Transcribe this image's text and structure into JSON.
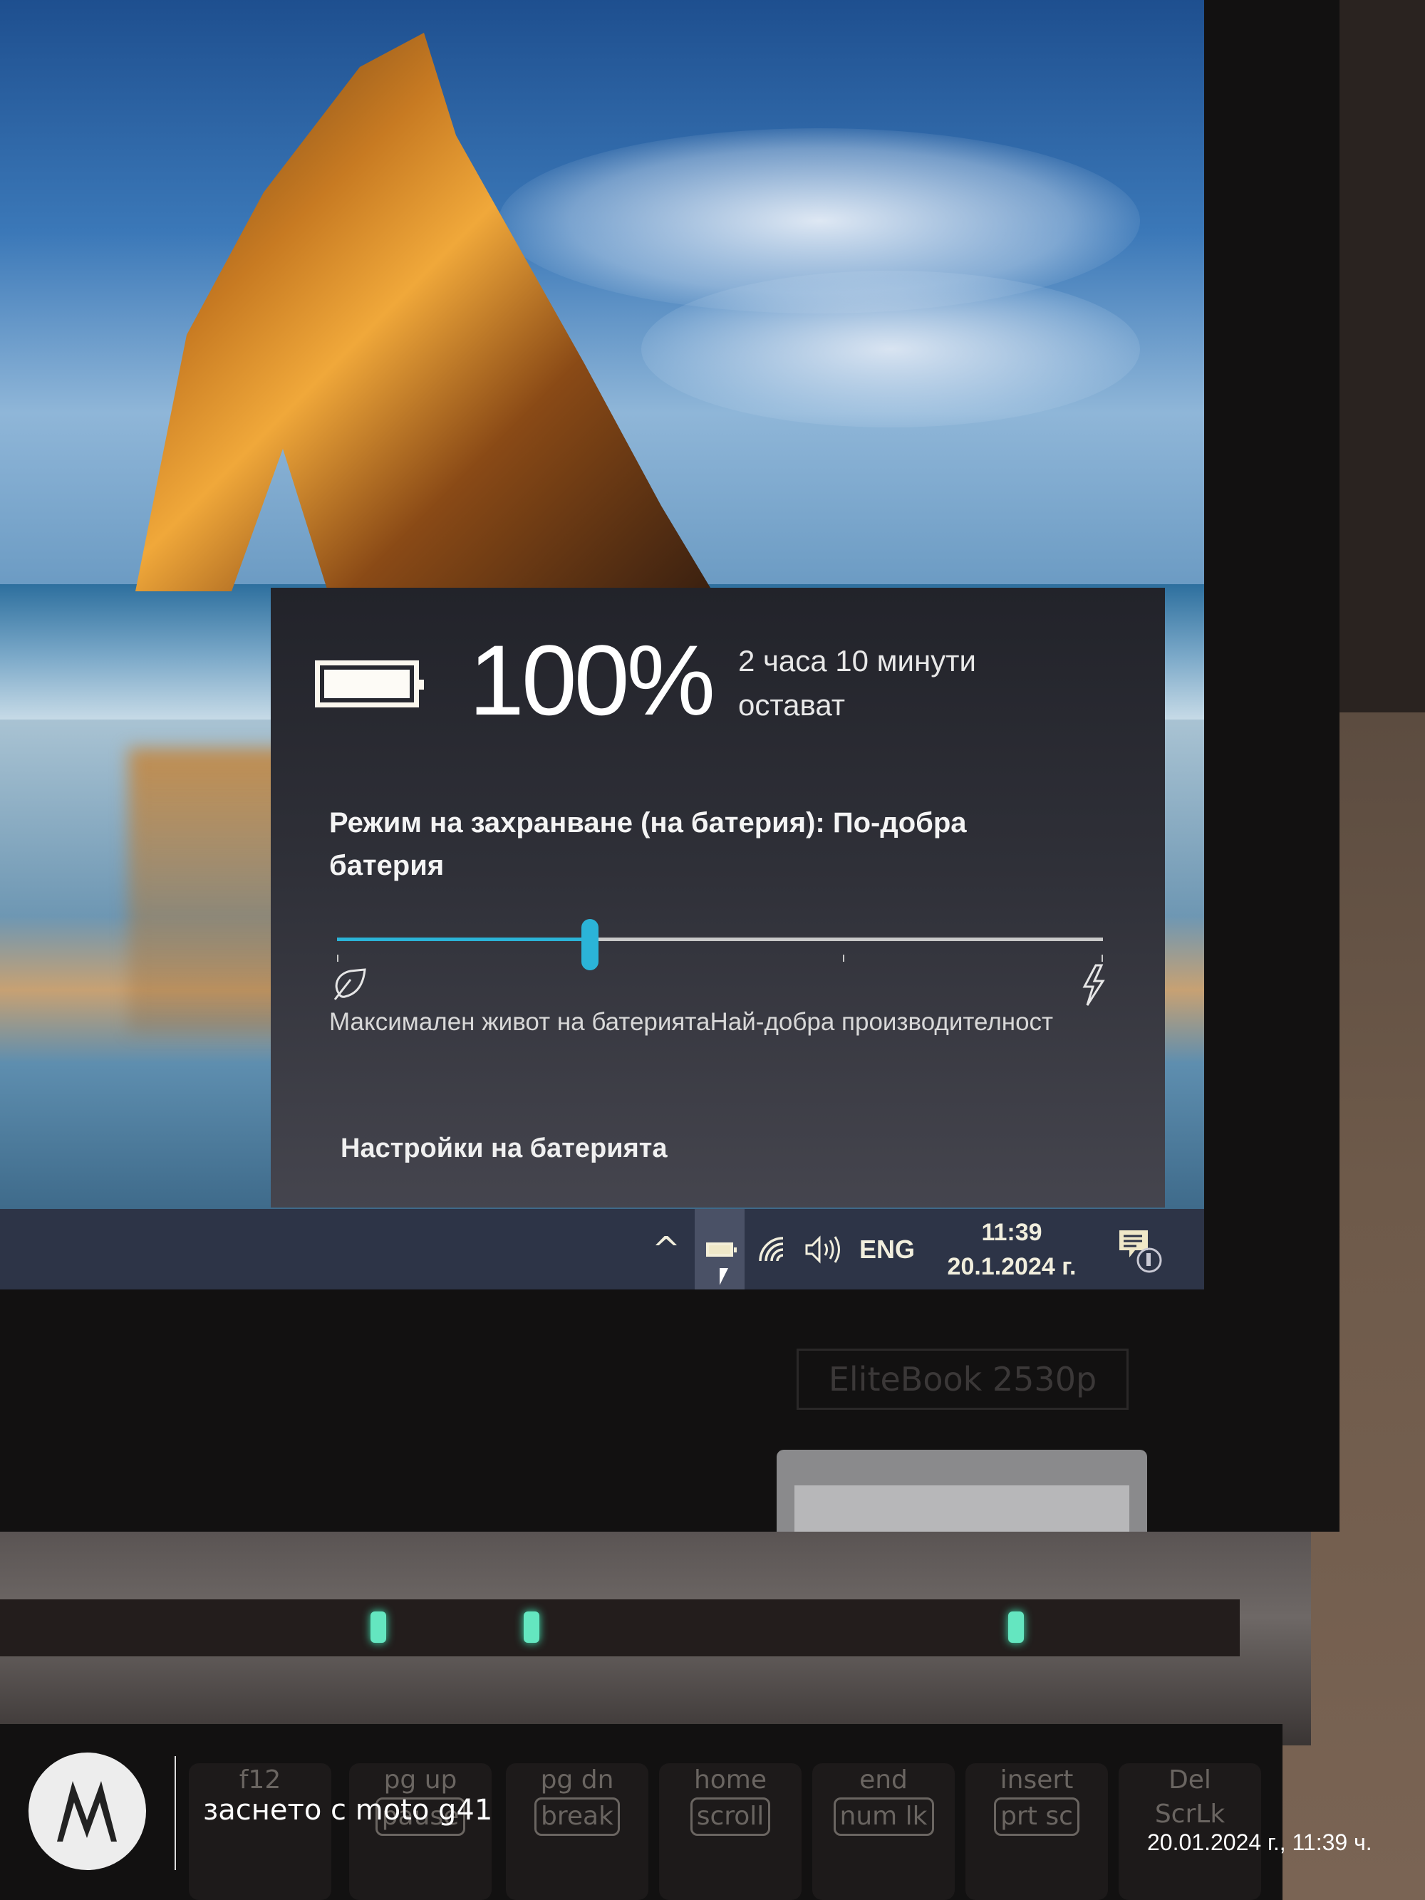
{
  "flyout": {
    "battery_percent_label": "100%",
    "battery_level_percent": 100,
    "time_remaining_line1": "2 часа 10 минути",
    "time_remaining_line2": "остават",
    "power_mode_label": "Режим на захранване (на батерия): По-добра батерия",
    "slider": {
      "position_fraction": 0.33,
      "ticks_fraction": [
        0,
        0.66,
        1.0
      ],
      "left_icon": "leaf-icon",
      "right_icon": "lightning-bolt-icon",
      "left_label": "Максимален живот на батерията",
      "right_label": "Най-добра производителност",
      "accent_color": "#2bb4d8"
    },
    "settings_link": "Настройки на батерията"
  },
  "taskbar": {
    "show_hidden_icons": "^",
    "tray_icons": [
      "battery-icon",
      "wifi-icon",
      "volume-icon"
    ],
    "language": "ENG",
    "time": "11:39",
    "date": "20.1.2024 г.",
    "notification_icon": "action-center-icon"
  },
  "hardware": {
    "model_badge": "EliteBook 2530p",
    "keys": [
      {
        "top": "f12",
        "bottom": ""
      },
      {
        "top": "pg up",
        "bottom": "pause"
      },
      {
        "top": "pg dn",
        "bottom": "break"
      },
      {
        "top": "home",
        "bottom": "scroll"
      },
      {
        "top": "end",
        "bottom": "num lk"
      },
      {
        "top": "insert",
        "bottom": "prt sc"
      },
      {
        "top": "Del",
        "bottom": "ScrLk"
      }
    ]
  },
  "watermark": {
    "caption": "заснето с moto g41",
    "timestamp": "20.01.2024 г., 11:39 ч."
  }
}
